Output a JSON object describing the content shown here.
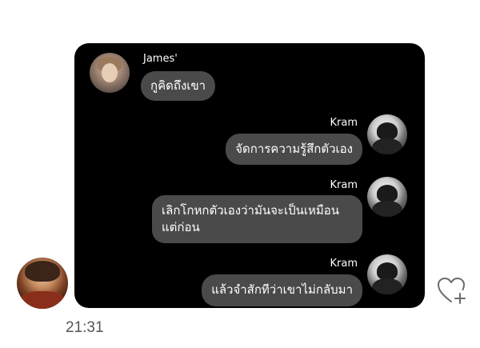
{
  "chat": {
    "time": "21:31",
    "messages": [
      {
        "sender": "James'",
        "text": "กูคิดถึงเขา"
      },
      {
        "sender": "Kram",
        "text": "จัดการความรู้สึกตัวเอง"
      },
      {
        "sender": "Kram",
        "text": "เลิกโกหกตัวเองว่ามันจะเป็นเหมือนแต่ก่อน"
      },
      {
        "sender": "Kram",
        "text": "แล้วจำสักทีว่าเขาไม่กลับมา"
      }
    ]
  },
  "icons": {
    "like": "heart-plus-icon"
  },
  "colors": {
    "card_background": "#000000",
    "bubble": "#4a4a4a",
    "time_text": "#555555"
  }
}
